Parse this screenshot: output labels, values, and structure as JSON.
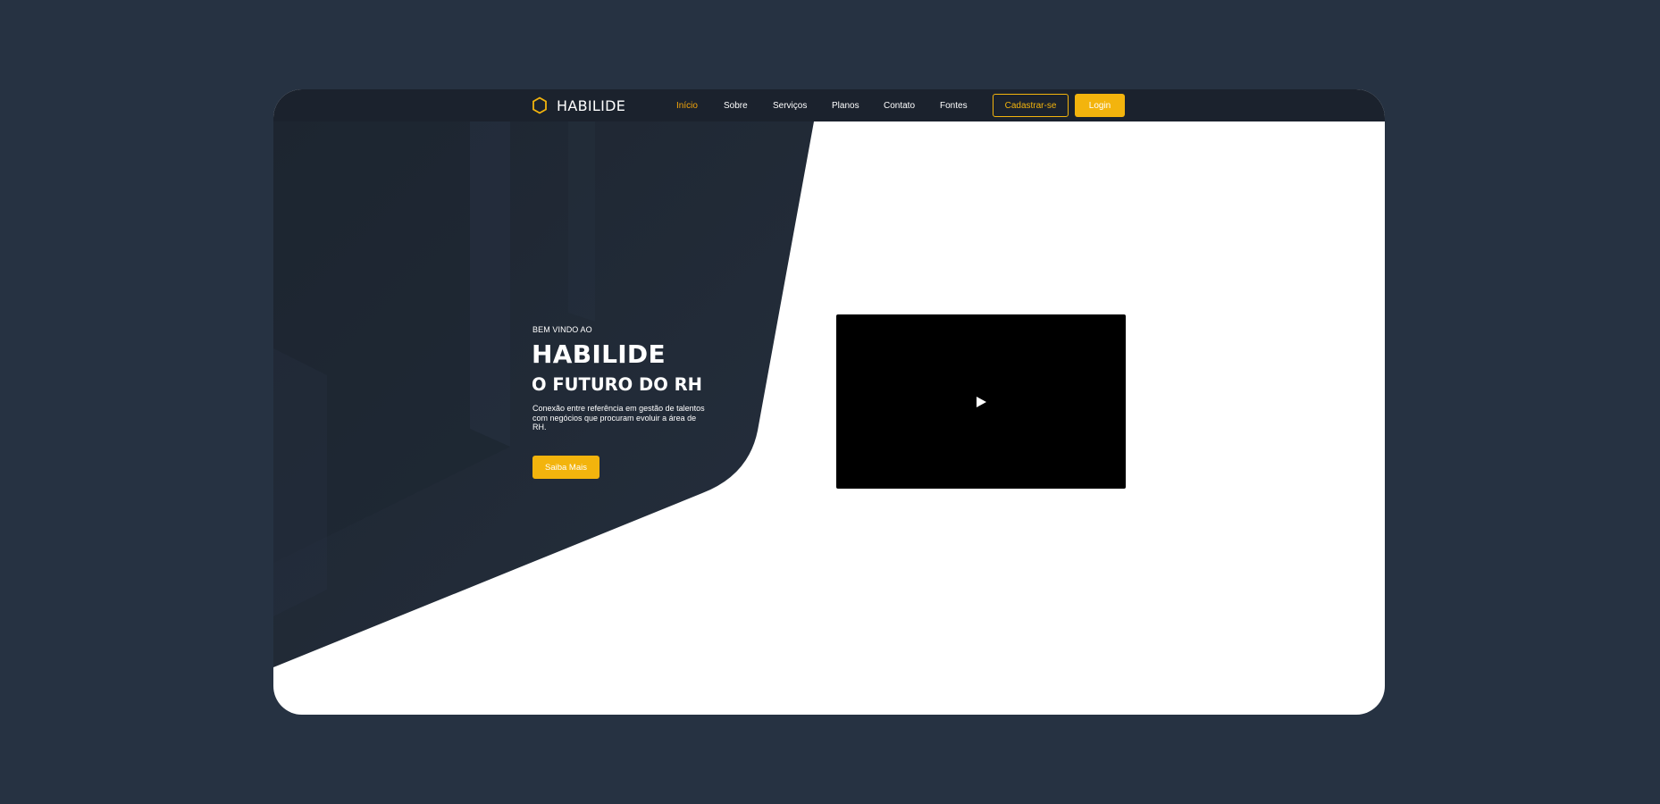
{
  "colors": {
    "page_background": "#263242",
    "navbar_background": "#1b222d",
    "accent": "#f3b40d",
    "active_link": "#f5a60a",
    "hero_dark": "#222b37",
    "content_background": "#ffffff",
    "video_background": "#000000"
  },
  "navbar": {
    "logo_icon": "hexagon-icon",
    "brand_name": "HABILIDE",
    "links": [
      {
        "label": "Início",
        "active": true
      },
      {
        "label": "Sobre",
        "active": false
      },
      {
        "label": "Serviços",
        "active": false
      },
      {
        "label": "Planos",
        "active": false
      },
      {
        "label": "Contato",
        "active": false
      },
      {
        "label": "Fontes",
        "active": false
      }
    ],
    "signup_label": "Cadastrar-se",
    "login_label": "Login"
  },
  "hero": {
    "eyebrow": "BEM VINDO AO",
    "title": "HABILIDE",
    "subtitle": "O FUTURO DO RH",
    "description": "Conexão entre referência em gestão de talentos com negócios que procuram evoluir a área de RH.",
    "cta_label": "Saiba Mais"
  },
  "video": {
    "play_icon": "play-icon"
  }
}
